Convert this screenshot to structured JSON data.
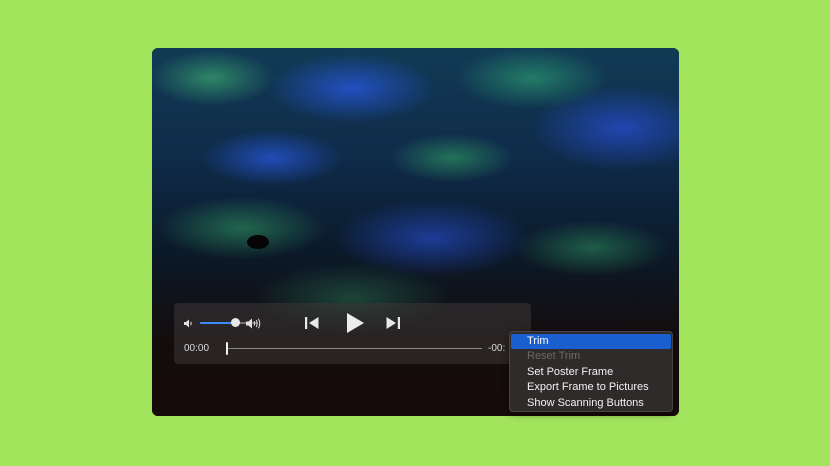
{
  "player": {
    "current_time": "00:00",
    "remaining_time": "-00:",
    "volume_level": 0.62,
    "playback_progress": 0.0
  },
  "context_menu": {
    "items": [
      {
        "label": "Trim",
        "state": "highlighted"
      },
      {
        "label": "Reset Trim",
        "state": "disabled"
      },
      {
        "label": "Set Poster Frame",
        "state": "enabled"
      },
      {
        "label": "Export Frame to Pictures",
        "state": "enabled"
      },
      {
        "label": "Show Scanning Buttons",
        "state": "enabled"
      }
    ]
  },
  "icons": {
    "volume_low": "speaker-low-icon",
    "volume_high": "speaker-high-icon",
    "skip_back": "skip-back-icon",
    "play": "play-icon",
    "skip_forward": "skip-forward-icon"
  },
  "colors": {
    "background": "#a3e45d",
    "accent": "#1a5fd0",
    "volume_fill": "#3d8cff"
  }
}
